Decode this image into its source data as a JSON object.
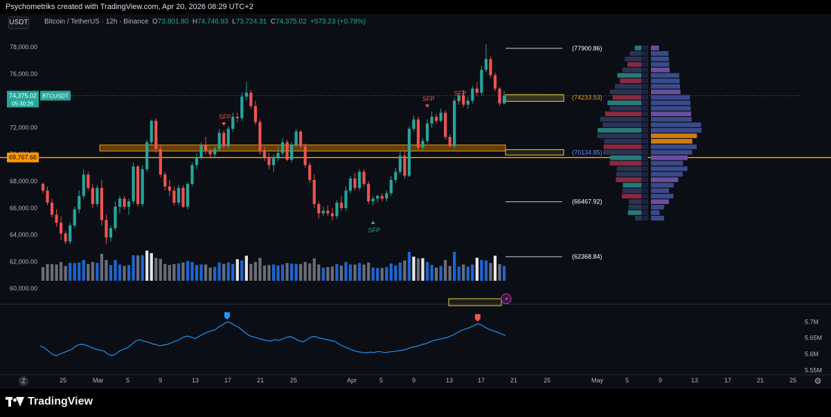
{
  "topbar": {
    "caption": "Psychometriks created with TradingView.com, Apr 20, 2026 08:29 UTC+2"
  },
  "toolbar": {
    "symbol_button": "USDT"
  },
  "legend": {
    "title": "Bitcoin / TetherUS · 12h · Binance",
    "o_label": "O",
    "o": "73,801.80",
    "h_label": "H",
    "h": "74,746.93",
    "l_label": "L",
    "l": "73,724.31",
    "c_label": "C",
    "c": "74,375.02",
    "change": "+573.23 (+0.78%)"
  },
  "colors": {
    "up": "#26a69a",
    "down": "#ef5350",
    "orange": "#ff9800",
    "blue_line": "#2196f3",
    "vol_blue": "#1e66d0",
    "vol_gray": "#6b6e78",
    "vol_white": "#e8e8e8",
    "yellow": "#f5d142"
  },
  "price_axis": {
    "labels": [
      "78,000.00",
      "76,000.00",
      "74,000.00",
      "72,000.00",
      "70,000.00",
      "68,000.00",
      "66,000.00",
      "64,000.00",
      "62,000.00",
      "60,000.00"
    ],
    "current_price_tag": {
      "price": "74,375.02",
      "countdown": "05:30:26",
      "symbol": "BTCUSDT"
    },
    "orange_tag": "69,767.66"
  },
  "levels": [
    {
      "label": "(77900.86)",
      "color": "#ffffff"
    },
    {
      "label": "(74233.93)",
      "color": "#ff9800"
    },
    {
      "label": "(70134.85)",
      "color": "#6e8bff"
    },
    {
      "label": "(66467.92)",
      "color": "#ffffff"
    },
    {
      "label": "(62368.84)",
      "color": "#ffffff"
    }
  ],
  "annotations": [
    "SFP",
    "SFP",
    "SFP",
    "SFP"
  ],
  "indicator_axis": {
    "labels": [
      "5.7M",
      "5.65M",
      "5.6M",
      "5.55M"
    ]
  },
  "time_axis": {
    "labels": [
      "25",
      "Mar",
      "5",
      "9",
      "13",
      "17",
      "21",
      "25",
      "Apr",
      "5",
      "9",
      "13",
      "17",
      "21",
      "25",
      "May",
      "5",
      "9",
      "13",
      "17",
      "21",
      "25"
    ]
  },
  "time_axis_extra": {
    "tz_button": "Z"
  },
  "footer": {
    "brand": "TradingView"
  },
  "chart_data": {
    "type": "candlestick",
    "title": "Bitcoin / TetherUS · 12h · Binance",
    "ylim": [
      59000,
      79000
    ],
    "candles": [
      [
        67800,
        67900,
        67100,
        67300
      ],
      [
        67300,
        67600,
        66200,
        66400
      ],
      [
        66400,
        66700,
        65300,
        65500
      ],
      [
        65500,
        65900,
        64600,
        64900
      ],
      [
        64900,
        65400,
        63600,
        64100
      ],
      [
        64100,
        64300,
        63300,
        63500
      ],
      [
        63500,
        64900,
        63300,
        64700
      ],
      [
        64700,
        66100,
        64500,
        65900
      ],
      [
        65900,
        67300,
        65600,
        66900
      ],
      [
        66900,
        68900,
        66700,
        68500
      ],
      [
        68500,
        68700,
        67300,
        67500
      ],
      [
        67500,
        67800,
        66000,
        66300
      ],
      [
        66300,
        67700,
        66100,
        67500
      ],
      [
        67500,
        68100,
        64700,
        65100
      ],
      [
        65100,
        65500,
        63300,
        63800
      ],
      [
        63800,
        64700,
        63500,
        64500
      ],
      [
        64500,
        66500,
        64300,
        66100
      ],
      [
        66100,
        66900,
        65600,
        66700
      ],
      [
        66700,
        66900,
        65900,
        66100
      ],
      [
        66100,
        66700,
        65500,
        66500
      ],
      [
        66500,
        69400,
        66300,
        69100
      ],
      [
        69100,
        69200,
        66100,
        66300
      ],
      [
        66300,
        69200,
        66100,
        68900
      ],
      [
        68900,
        71100,
        68700,
        70900
      ],
      [
        70900,
        72600,
        70700,
        72500
      ],
      [
        72500,
        72700,
        70100,
        70400
      ],
      [
        70400,
        70700,
        68300,
        68500
      ],
      [
        68500,
        68700,
        67300,
        67600
      ],
      [
        67600,
        68100,
        66900,
        67300
      ],
      [
        67300,
        67600,
        66200,
        66400
      ],
      [
        66400,
        67700,
        66200,
        67500
      ],
      [
        67500,
        67700,
        66000,
        66100
      ],
      [
        66100,
        67900,
        65900,
        67800
      ],
      [
        67800,
        69400,
        67600,
        69200
      ],
      [
        69200,
        70100,
        68900,
        69800
      ],
      [
        69800,
        70900,
        69600,
        70700
      ],
      [
        70700,
        71300,
        70000,
        70300
      ],
      [
        70300,
        70400,
        69700,
        70000
      ],
      [
        70000,
        70600,
        69800,
        70400
      ],
      [
        70400,
        71900,
        70200,
        71600
      ],
      [
        71600,
        71800,
        70400,
        70600
      ],
      [
        70600,
        72100,
        70400,
        71900
      ],
      [
        71900,
        73100,
        71700,
        72800
      ],
      [
        72800,
        73100,
        72400,
        72700
      ],
      [
        72700,
        74600,
        72500,
        74300
      ],
      [
        74300,
        75400,
        74000,
        74600
      ],
      [
        74600,
        74800,
        73400,
        73600
      ],
      [
        73600,
        74000,
        72200,
        72400
      ],
      [
        72400,
        72600,
        70000,
        70300
      ],
      [
        70300,
        70600,
        69500,
        69800
      ],
      [
        69800,
        70100,
        68900,
        69200
      ],
      [
        69200,
        70000,
        68700,
        69700
      ],
      [
        69700,
        70600,
        69500,
        70100
      ],
      [
        70100,
        71200,
        69900,
        70900
      ],
      [
        70900,
        71100,
        69500,
        69600
      ],
      [
        69600,
        70900,
        69400,
        70700
      ],
      [
        70700,
        71900,
        70500,
        71700
      ],
      [
        71700,
        71800,
        70400,
        70600
      ],
      [
        70600,
        70800,
        69000,
        69200
      ],
      [
        69200,
        69400,
        67900,
        68100
      ],
      [
        68100,
        68500,
        66000,
        66300
      ],
      [
        66300,
        66500,
        65200,
        65600
      ],
      [
        65600,
        66100,
        65400,
        65800
      ],
      [
        65800,
        66200,
        65400,
        65600
      ],
      [
        65600,
        66000,
        65100,
        65400
      ],
      [
        65400,
        66600,
        65200,
        66400
      ],
      [
        66400,
        66900,
        65800,
        66000
      ],
      [
        66000,
        67600,
        65800,
        67300
      ],
      [
        67300,
        68400,
        67100,
        68200
      ],
      [
        68200,
        68600,
        67300,
        67500
      ],
      [
        67500,
        68900,
        67300,
        68700
      ],
      [
        68700,
        68900,
        67600,
        67800
      ],
      [
        67800,
        68000,
        66300,
        66500
      ],
      [
        66500,
        66900,
        66200,
        66700
      ],
      [
        66700,
        67000,
        66400,
        66900
      ],
      [
        66900,
        67100,
        66500,
        66700
      ],
      [
        66700,
        67300,
        66500,
        67100
      ],
      [
        67100,
        68400,
        66900,
        68100
      ],
      [
        68100,
        69000,
        67900,
        68700
      ],
      [
        68700,
        70200,
        68500,
        69900
      ],
      [
        69900,
        70300,
        68200,
        68400
      ],
      [
        68400,
        72100,
        68300,
        71900
      ],
      [
        71900,
        72900,
        71700,
        72600
      ],
      [
        72600,
        72800,
        70300,
        70500
      ],
      [
        70500,
        71200,
        70300,
        71000
      ],
      [
        71000,
        72600,
        70800,
        72300
      ],
      [
        72300,
        73200,
        72000,
        72800
      ],
      [
        72800,
        73000,
        72300,
        72500
      ],
      [
        72500,
        73400,
        72400,
        73100
      ],
      [
        73100,
        73300,
        71100,
        71300
      ],
      [
        71300,
        71500,
        70500,
        70600
      ],
      [
        70600,
        74200,
        70400,
        74000
      ],
      [
        74000,
        74600,
        73700,
        74400
      ],
      [
        74400,
        74800,
        73500,
        73700
      ],
      [
        73700,
        74300,
        73400,
        74000
      ],
      [
        74000,
        75100,
        73800,
        74900
      ],
      [
        74900,
        75400,
        74400,
        74600
      ],
      [
        74600,
        76600,
        74400,
        76300
      ],
      [
        76300,
        78200,
        76100,
        77100
      ],
      [
        77100,
        77300,
        75700,
        75900
      ],
      [
        75900,
        76100,
        74700,
        74900
      ],
      [
        74900,
        75000,
        73600,
        73800
      ],
      [
        73800,
        74746,
        73724,
        74375
      ]
    ],
    "volume_colors": "per-candle (blue = up, gray = down, white = spike)",
    "horizontal_levels": [
      77900.86,
      74233.93,
      70134.85,
      66467.92,
      62368.84
    ],
    "orange_level": 69767.66,
    "zones": [
      {
        "color": "orange",
        "from": 70250,
        "to": 70700
      },
      {
        "color": "yellow",
        "from": 73950,
        "to": 74450
      },
      {
        "color": "yellow",
        "from": 69950,
        "to": 70350
      }
    ],
    "indicator": {
      "name": "",
      "ylim": [
        5.54,
        5.72
      ],
      "values": [
        5.625,
        5.62,
        5.61,
        5.6,
        5.595,
        5.6,
        5.605,
        5.61,
        5.615,
        5.625,
        5.63,
        5.63,
        5.625,
        5.62,
        5.615,
        5.612,
        5.61,
        5.6,
        5.595,
        5.6,
        5.61,
        5.615,
        5.62,
        5.63,
        5.64,
        5.645,
        5.64,
        5.638,
        5.632,
        5.63,
        5.625,
        5.628,
        5.63,
        5.635,
        5.64,
        5.645,
        5.652,
        5.656,
        5.652,
        5.648,
        5.655,
        5.662,
        5.668,
        5.672,
        5.675,
        5.685,
        5.692,
        5.7,
        5.696,
        5.688,
        5.682,
        5.672,
        5.662,
        5.655,
        5.652,
        5.648,
        5.645,
        5.642,
        5.64,
        5.645,
        5.642,
        5.647,
        5.652,
        5.654,
        5.648,
        5.642,
        5.638,
        5.644,
        5.652,
        5.655,
        5.65,
        5.648,
        5.645,
        5.642,
        5.64,
        5.632,
        5.625,
        5.62,
        5.615,
        5.61,
        5.607,
        5.605,
        5.604,
        5.606,
        5.605,
        5.608,
        5.606,
        5.605,
        5.607,
        5.608,
        5.61,
        5.612,
        5.615,
        5.62,
        5.622,
        5.625,
        5.63,
        5.632,
        5.638,
        5.642,
        5.645,
        5.648,
        5.65,
        5.655,
        5.66,
        5.668,
        5.674,
        5.678,
        5.682,
        5.688,
        5.694,
        5.69,
        5.682,
        5.676,
        5.672,
        5.668,
        5.662,
        5.658
      ]
    }
  }
}
